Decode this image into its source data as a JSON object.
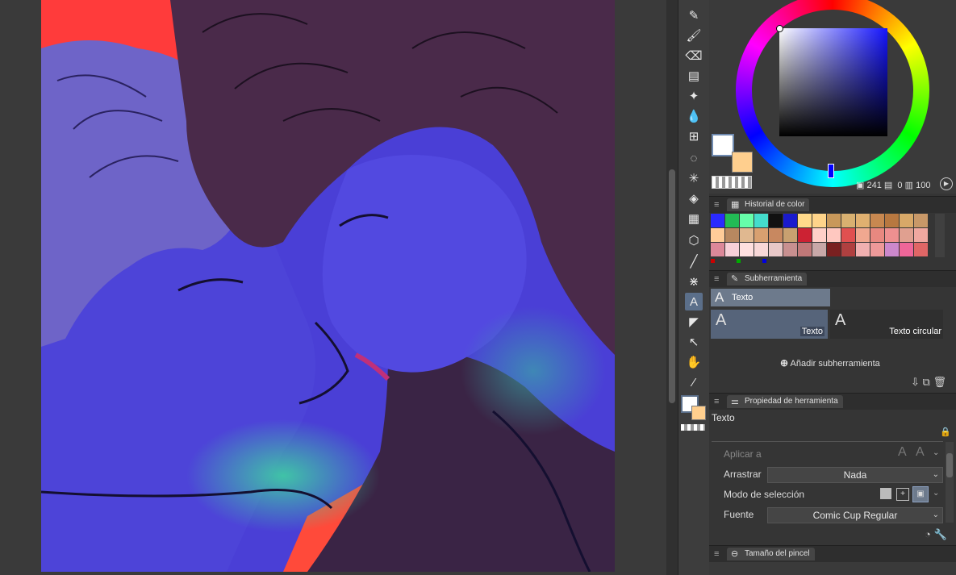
{
  "color_wheel": {
    "hue_value": "241",
    "saturation_value": "0",
    "brightness_value": "100"
  },
  "color_history": {
    "tab_label": "Historial de color",
    "swatches": [
      "#2a2aff",
      "#22bb55",
      "#66ffaa",
      "#44ddcc",
      "#111111",
      "#1a1acc",
      "#ffd98a",
      "#ffd48a",
      "#c8985a",
      "#d8b070",
      "#e0b070",
      "#c88850",
      "#b87840",
      "#d8a868",
      "#c89868",
      "#ffcc99",
      "#b88860",
      "#e0b890",
      "#d8a070",
      "#c88860",
      "#c8a070",
      "#cc2233",
      "#ffd0c8",
      "#ffc8c0",
      "#e05050",
      "#f0a890",
      "#e88880",
      "#ee9090",
      "#e0a090",
      "#f0a8a0",
      "#dd8899",
      "#f8d0d8",
      "#ffe0e0",
      "#f8d8d8",
      "#e8c8c8",
      "#c89090",
      "#c07878",
      "#c8a8a8",
      "#7a2020",
      "#b04040",
      "#f0b0b0",
      "#ee9999",
      "#cc88cc",
      "#ee6699",
      "#e06666"
    ]
  },
  "subtool": {
    "tab_label": "Subherramienta",
    "group_label": "Texto",
    "items": [
      "Texto",
      "Texto circular"
    ],
    "add_label": "Añadir subherramienta"
  },
  "tool_property": {
    "tab_label": "Propiedad de herramienta",
    "tool_name": "Texto",
    "apply_label": "Aplicar a",
    "drag_label": "Arrastrar",
    "drag_value": "Nada",
    "selection_mode_label": "Modo de selección",
    "font_label": "Fuente",
    "font_value": "Comic Cup Regular"
  },
  "brush_size": {
    "tab_label": "Tamaño del pincel"
  },
  "colors": {
    "main_color": "#ffffff",
    "sub_color": "#ffcf8e",
    "active_accent": "#5b6f8a"
  }
}
